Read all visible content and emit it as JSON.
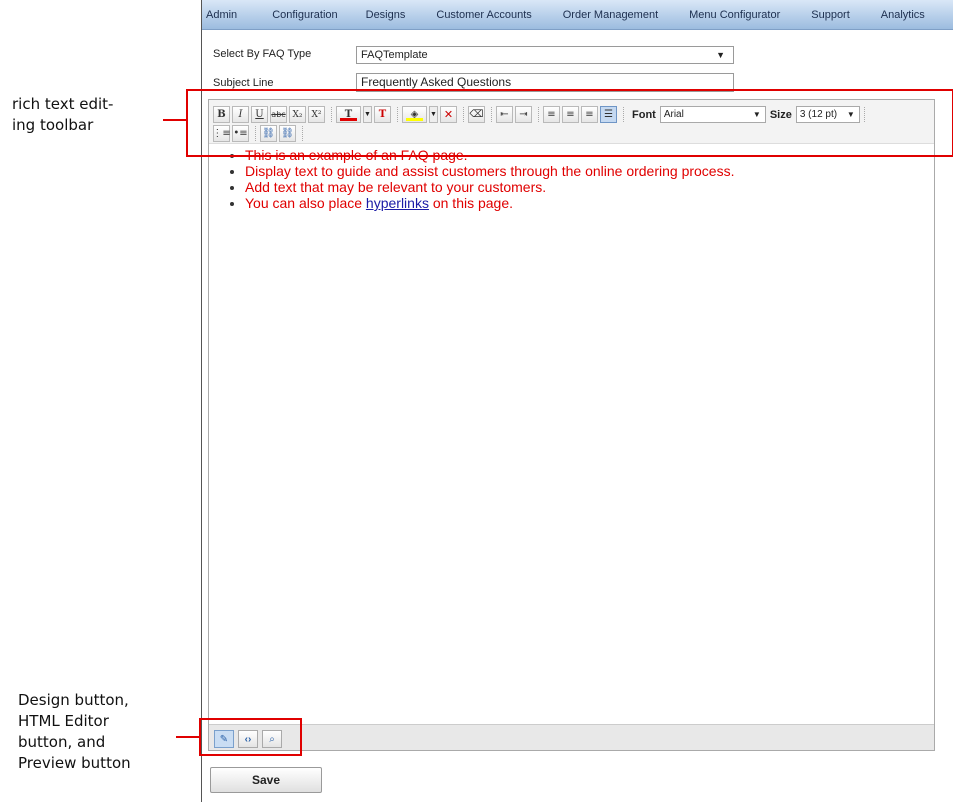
{
  "nav": {
    "items": [
      "Admin",
      "Configuration",
      "Designs",
      "Customer Accounts",
      "Order Management",
      "Menu Configurator",
      "Support",
      "Analytics"
    ]
  },
  "form": {
    "faq_type_label": "Select By FAQ Type",
    "faq_type_value": "FAQTemplate",
    "subject_label": "Subject Line",
    "subject_value": "Frequently Asked Questions"
  },
  "toolbar": {
    "bold": "B",
    "italic": "I",
    "underline": "U",
    "strike": "abc",
    "subscript": "X₂",
    "superscript": "X²",
    "font_label": "Font",
    "font_value": "Arial",
    "size_label": "Size",
    "size_value": "3 (12 pt)",
    "text_color": "#e00000",
    "highlight_color": "#ffff00"
  },
  "content": {
    "items": [
      "This is an example of an FAQ page.",
      "Display text to guide and assist customers through the online ordering process.",
      "Add text that may be relevant to your customers."
    ],
    "last_prefix": "You can also place ",
    "last_link": "hyperlinks",
    "last_suffix": " on this page."
  },
  "buttons": {
    "save": "Save"
  },
  "annotations": {
    "toolbar_line1": "rich text edit-",
    "toolbar_line2": "ing toolbar",
    "modes_line1": "Design button,",
    "modes_line2": "HTML Editor",
    "modes_line3": "button, and",
    "modes_line4": "Preview button"
  },
  "colors": {
    "annotation": "#e00000",
    "nav_gradient_top": "#d9e7f7",
    "nav_gradient_bottom": "#9cbcdf",
    "link": "#1a1aa6"
  }
}
